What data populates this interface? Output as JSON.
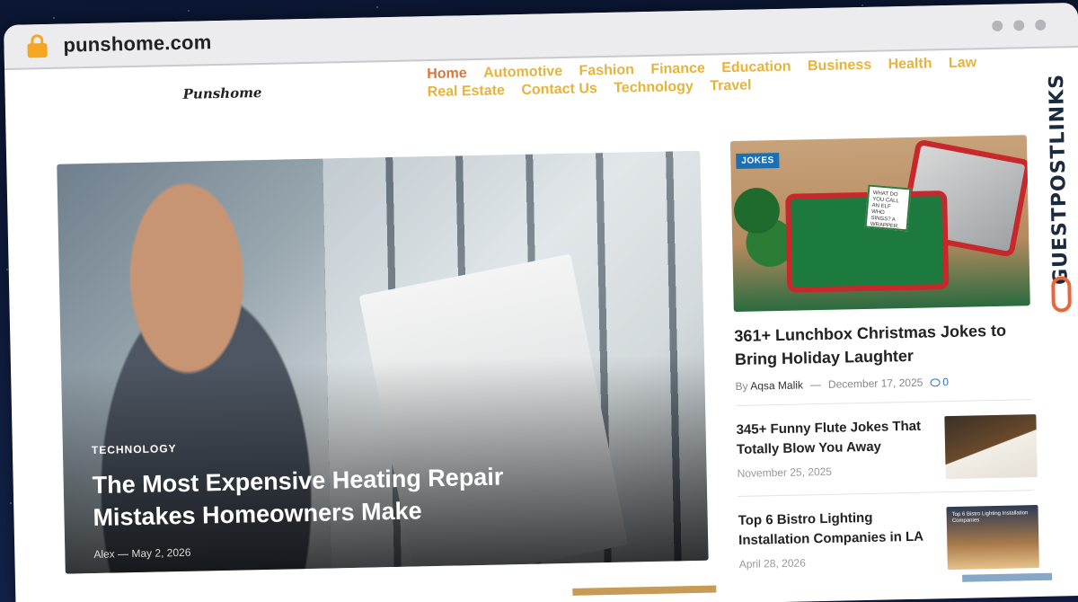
{
  "browser": {
    "url": "punshome.com"
  },
  "site": {
    "logo_text": "Punshome"
  },
  "nav": {
    "items": [
      {
        "label": "Home",
        "active": true
      },
      {
        "label": "Automotive"
      },
      {
        "label": "Fashion"
      },
      {
        "label": "Finance"
      },
      {
        "label": "Education"
      },
      {
        "label": "Business"
      },
      {
        "label": "Health"
      },
      {
        "label": "Law"
      },
      {
        "label": "Real Estate"
      },
      {
        "label": "Contact Us"
      },
      {
        "label": "Technology"
      },
      {
        "label": "Travel"
      }
    ]
  },
  "hero": {
    "category": "TECHNOLOGY",
    "title": "The Most Expensive Heating Repair Mistakes Homeowners Make",
    "author": "Alex",
    "date": "May 2, 2026"
  },
  "feature": {
    "tag": "JOKES",
    "note_text": "WHAT DO YOU CALL AN ELF WHO SINGS? A WRAPPER.",
    "title": "361+ Lunchbox Christmas Jokes to Bring Holiday Laughter",
    "by_label": "By",
    "author": "Aqsa Malik",
    "date": "December 17, 2025",
    "comments": "0"
  },
  "list": [
    {
      "title": "345+ Funny Flute Jokes That Totally Blow You Away",
      "date": "November 25, 2025"
    },
    {
      "title": "Top 6 Bistro Lighting Installation Companies in LA",
      "date": "April 28, 2026",
      "thumb_text": "Top 6 Bistro Lighting Installation Companies"
    }
  ],
  "watermark": {
    "text": "GUESTPOSTLINKS"
  },
  "colors": {
    "nav_link": "#e8b33a",
    "nav_active": "#d9773a",
    "tag_bg": "#1b6fb3",
    "lock": "#f5a623"
  }
}
